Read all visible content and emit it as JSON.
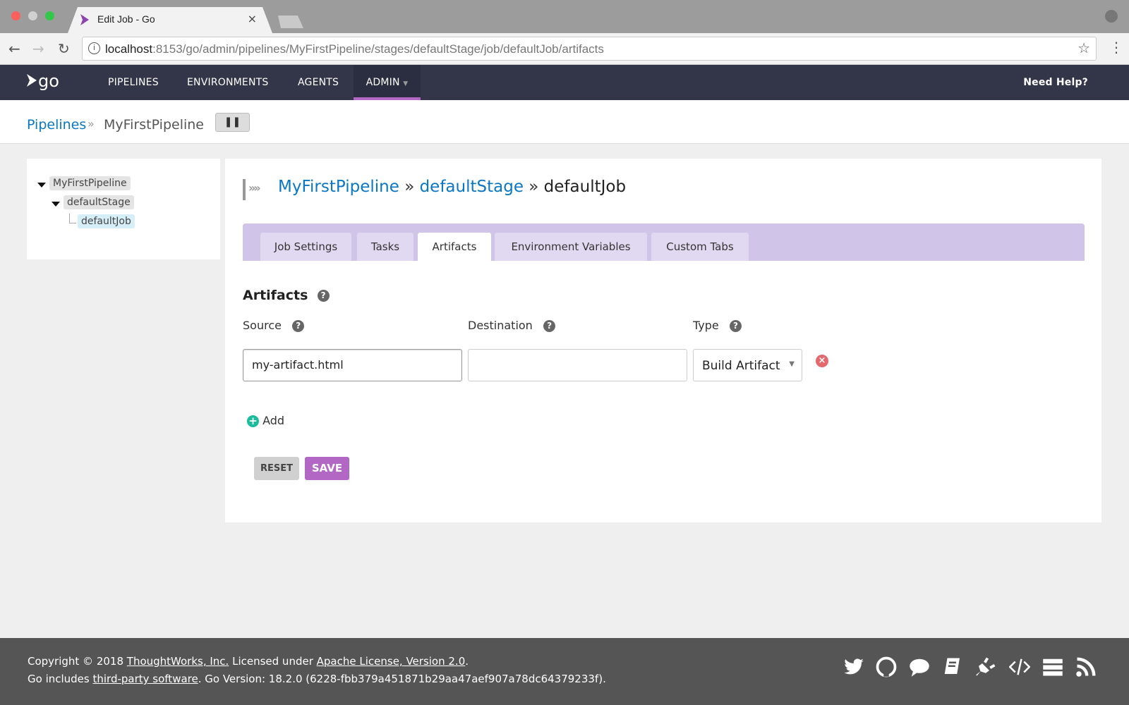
{
  "browser": {
    "tab_title": "Edit Job - Go",
    "url_host": "localhost",
    "url_rest": ":8153/go/admin/pipelines/MyFirstPipeline/stages/defaultStage/job/defaultJob/artifacts"
  },
  "nav": {
    "logo": "go",
    "items": [
      "PIPELINES",
      "ENVIRONMENTS",
      "AGENTS",
      "ADMIN"
    ],
    "help": "Need Help?"
  },
  "breadcrumb": {
    "root": "Pipelines",
    "sep": "»",
    "current": "MyFirstPipeline",
    "pause_icon": "pause-icon"
  },
  "tree": {
    "pipeline": "MyFirstPipeline",
    "stage": "defaultStage",
    "job": "defaultJob"
  },
  "header": {
    "pipeline": "MyFirstPipeline",
    "stage": "defaultStage",
    "job": "defaultJob",
    "sep": "»"
  },
  "tabs": [
    "Job Settings",
    "Tasks",
    "Artifacts",
    "Environment Variables",
    "Custom Tabs"
  ],
  "active_tab": "Artifacts",
  "artifacts": {
    "title": "Artifacts",
    "columns": [
      "Source",
      "Destination",
      "Type"
    ],
    "rows": [
      {
        "source": "my-artifact.html",
        "destination": "",
        "type": "Build Artifact"
      }
    ],
    "add": "Add"
  },
  "buttons": {
    "reset": "RESET",
    "save": "SAVE"
  },
  "footer": {
    "l1a": "Copyright © 2018 ",
    "l1b": "ThoughtWorks, Inc.",
    "l1c": " Licensed under ",
    "l1d": "Apache License, Version 2.0",
    "l1e": ".",
    "l2a": "Go includes ",
    "l2b": "third-party software",
    "l2c": ". Go Version: 18.2.0 (6228-fbb379a451871b29aa47aef907a78dc64379233f).",
    "icons": [
      "twitter-icon",
      "github-icon",
      "chat-icon",
      "docs-icon",
      "plugin-icon",
      "api-icon",
      "server-icon",
      "rss-icon"
    ]
  },
  "colors": {
    "nav": "#333649",
    "accent": "#b367c5",
    "link": "#0a77c4",
    "tabs": "#d1c4e9",
    "add": "#1abc9c",
    "delete": "#e5686c"
  }
}
